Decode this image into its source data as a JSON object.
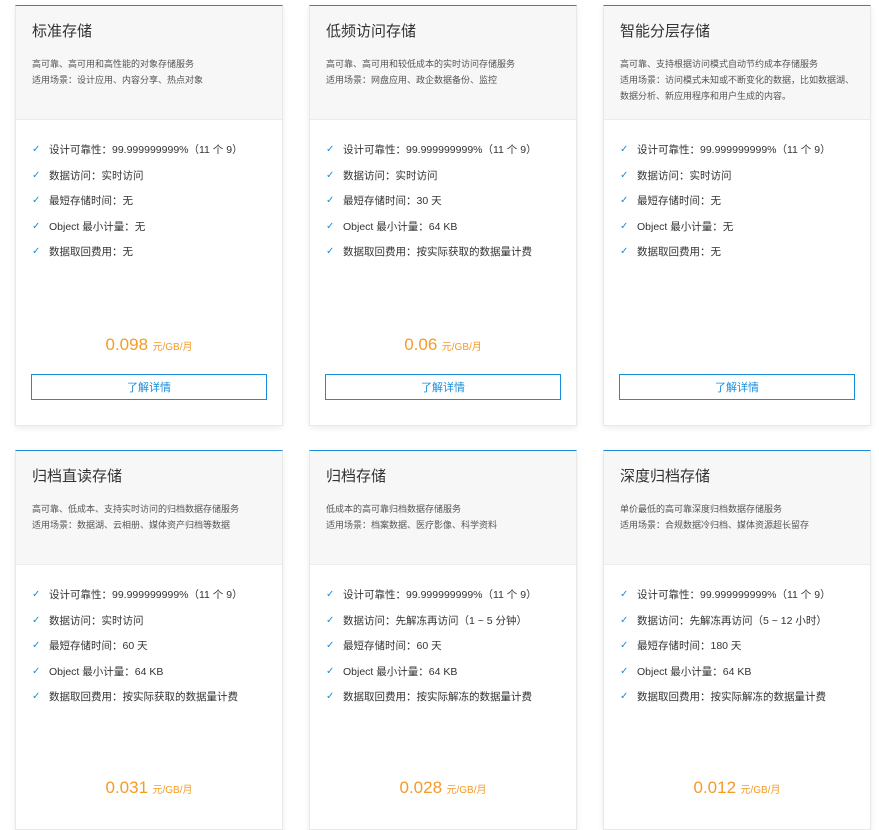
{
  "accent_color": "#1a8dd8",
  "price_color": "#f59b26",
  "button_label": "了解详情",
  "cards": [
    {
      "title": "标准存储",
      "desc": [
        "高可靠、高可用和高性能的对象存储服务",
        "适用场景：设计应用、内容分享、热点对象"
      ],
      "features": [
        "设计可靠性：99.999999999%（11 个 9）",
        "数据访问：实时访问",
        "最短存储时间：无",
        "Object 最小计量：无",
        "数据取回费用：无"
      ],
      "price": "0.098",
      "unit": "元/GB/月"
    },
    {
      "title": "低频访问存储",
      "desc": [
        "高可靠、高可用和较低成本的实时访问存储服务",
        "适用场景：网盘应用、政企数据备份、监控"
      ],
      "features": [
        "设计可靠性：99.999999999%（11 个 9）",
        "数据访问：实时访问",
        "最短存储时间：30 天",
        "Object 最小计量：64 KB",
        "数据取回费用：按实际获取的数据量计费"
      ],
      "price": "0.06",
      "unit": "元/GB/月"
    },
    {
      "title": "智能分层存储",
      "desc": [
        "高可靠、支持根据访问模式自动节约成本存储服务",
        "适用场景：访问模式未知或不断变化的数据，比如数据湖、",
        "数据分析、新应用程序和用户生成的内容。"
      ],
      "features": [
        "设计可靠性：99.999999999%（11 个 9）",
        "数据访问：实时访问",
        "最短存储时间：无",
        "Object 最小计量：无",
        "数据取回费用：无"
      ],
      "price": null,
      "unit": null
    },
    {
      "title": "归档直读存储",
      "desc": [
        "高可靠、低成本、支持实时访问的归档数据存储服务",
        "适用场景：数据湖、云相册、媒体资产归档等数据"
      ],
      "features": [
        "设计可靠性：99.999999999%（11 个 9）",
        "数据访问：实时访问",
        "最短存储时间：60 天",
        "Object 最小计量：64 KB",
        "数据取回费用：按实际获取的数据量计费"
      ],
      "price": "0.031",
      "unit": "元/GB/月"
    },
    {
      "title": "归档存储",
      "desc": [
        "低成本的高可靠归档数据存储服务",
        "适用场景：档案数据、医疗影像、科学资料"
      ],
      "features": [
        "设计可靠性：99.999999999%（11 个 9）",
        "数据访问：先解冻再访问（1 ~ 5 分钟）",
        "最短存储时间：60 天",
        "Object 最小计量：64 KB",
        "数据取回费用：按实际解冻的数据量计费"
      ],
      "price": "0.028",
      "unit": "元/GB/月"
    },
    {
      "title": "深度归档存储",
      "desc": [
        "单价最低的高可靠深度归档数据存储服务",
        "适用场景：合规数据冷归档、媒体资源超长留存"
      ],
      "features": [
        "设计可靠性：99.999999999%（11 个 9）",
        "数据访问：先解冻再访问（5 ~ 12 小时）",
        "最短存储时间：180 天",
        "Object 最小计量：64 KB",
        "数据取回费用：按实际解冻的数据量计费"
      ],
      "price": "0.012",
      "unit": "元/GB/月"
    }
  ]
}
